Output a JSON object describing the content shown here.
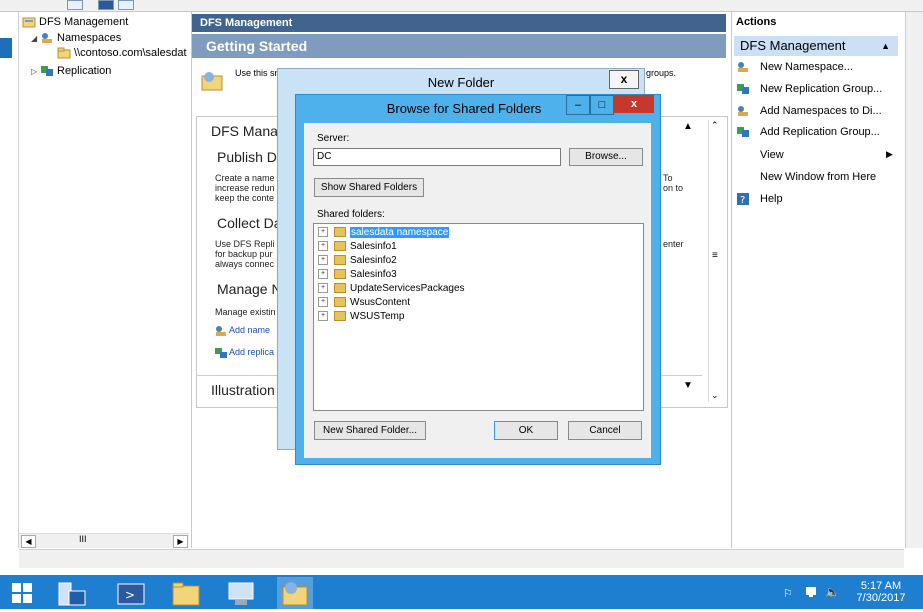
{
  "window": {
    "colors": {
      "accent": "#41648f",
      "dialog_title": "#4fb1ec",
      "taskbar": "#1e7ed0",
      "selection": "#3399ff",
      "close_red": "#c7382c"
    }
  },
  "tree": {
    "root": "DFS Management",
    "namespaces": "Namespaces",
    "namespace_path": "\\\\contoso.com\\salesdat",
    "replication": "Replication",
    "scroll_label": "III"
  },
  "center": {
    "header": "DFS Management",
    "getting_started": "Getting Started",
    "intro": "Use this sn",
    "intro_tail": "groups.",
    "frame_title": "DFS Manag",
    "sections": [
      {
        "title": "Publish Da",
        "text": [
          "Create a name",
          "increase redun",
          "keep the conte"
        ],
        "text_tail": [
          "To",
          "on to",
          ""
        ]
      },
      {
        "title": "Collect Da",
        "text": [
          "Use DFS Repli",
          "for backup pur",
          "always connec"
        ],
        "text_tail": [
          "enter",
          "",
          ""
        ]
      },
      {
        "title": "Manage N",
        "text": [
          "Manage existin"
        ],
        "text_tail": []
      }
    ],
    "links": [
      "Add name",
      "Add replica"
    ],
    "illustration": "Illustration"
  },
  "actions": {
    "title": "Actions",
    "band": "DFS Management",
    "items": [
      {
        "label": "New Namespace...",
        "icon": "namespace-icon"
      },
      {
        "label": "New Replication Group...",
        "icon": "replication-icon"
      },
      {
        "label": "Add Namespaces to Di...",
        "icon": "namespace-icon"
      },
      {
        "label": "Add Replication Group...",
        "icon": "replication-icon"
      },
      {
        "label": "View",
        "icon": "none"
      },
      {
        "label": "New Window from Here",
        "icon": "none"
      },
      {
        "label": "Help",
        "icon": "help-icon"
      }
    ]
  },
  "new_folder_dialog": {
    "title": "New Folder",
    "close": "x"
  },
  "browse_dialog": {
    "title": "Browse for Shared Folders",
    "minimize": "–",
    "maximize": "□",
    "close": "x",
    "server_label": "Server:",
    "server_value": "DC",
    "browse_button": "Browse...",
    "show_shared_button": "Show Shared Folders",
    "shared_folders_label": "Shared folders:",
    "shared_folders": [
      "salesdata namespace",
      "Salesinfo1",
      "Salesinfo2",
      "Salesinfo3",
      "UpdateServicesPackages",
      "WsusContent",
      "WSUSTemp"
    ],
    "selected_folder": "salesdata namespace",
    "new_shared_folder_button": "New Shared Folder...",
    "ok_button": "OK",
    "cancel_button": "Cancel"
  },
  "taskbar": {
    "time": "5:17 AM",
    "date": "7/30/2017"
  }
}
